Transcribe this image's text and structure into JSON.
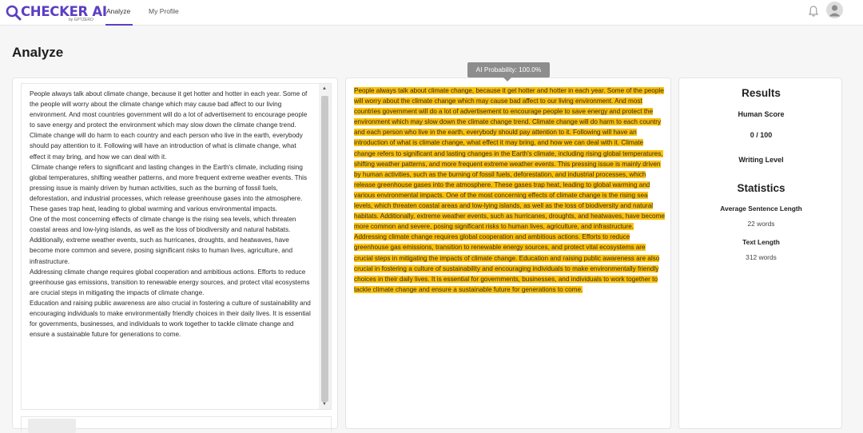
{
  "app": {
    "logo_text": "CHECKER AI",
    "logo_byline": "by GPTZERO",
    "brand_color": "#5c3ec2",
    "highlight_color": "#ffc107"
  },
  "nav": {
    "items": [
      {
        "label": "Analyze",
        "active": true
      },
      {
        "label": "My Profile",
        "active": false
      }
    ],
    "icons": [
      "bell-icon",
      "user-avatar-icon"
    ]
  },
  "page": {
    "title": "Analyze"
  },
  "input": {
    "text": "People always talk about climate change, because it get hotter and hotter in each year. Some of the people will worry about the climate change which may cause bad affect to our living environment. And most countries government will do a lot of advertisement to encourage people to save energy and protect the environment which may slow down the climate change trend. Climate change will do harm to each country and each person who live in the earth, everybody should pay attention to it. Following will have an introduction of what is climate change, what effect it may bring, and how we can deal with it.\n Climate change refers to significant and lasting changes in the Earth's climate, including rising global temperatures, shifting weather patterns, and more frequent extreme weather events. This pressing issue is mainly driven by human activities, such as the burning of fossil fuels, deforestation, and industrial processes, which release greenhouse gases into the atmosphere. These gases trap heat, leading to global warming and various environmental impacts.\nOne of the most concerning effects of climate change is the rising sea levels, which threaten coastal areas and low-lying islands, as well as the loss of biodiversity and natural habitats. Additionally, extreme weather events, such as hurricanes, droughts, and heatwaves, have become more common and severe, posing significant risks to human lives, agriculture, and infrastructure.\nAddressing climate change requires global cooperation and ambitious actions. Efforts to reduce greenhouse gas emissions, transition to renewable energy sources, and protect vital ecosystems are crucial steps in mitigating the impacts of climate change.\nEducation and raising public awareness are also crucial in fostering a culture of sustainability and encouraging individuals to make environmentally friendly choices in their daily lives. It is essential for governments, businesses, and individuals to work together to tackle climate change and ensure a sustainable future for generations to come."
  },
  "output": {
    "tooltip": "AI Probability: 100.0%",
    "highlighted_text": "People always talk about climate change, because it get hotter and hotter in each year. Some of the people will worry about the climate change which may cause bad affect to our living environment. And most countries government will do a lot of advertisement to encourage people to save energy and protect the environment which may slow down the climate change trend. Climate change will do harm to each country and each person who live in the earth, everybody should pay attention to it. Following will have an introduction of what is climate change, what effect it may bring, and how we can deal with it. Climate change refers to significant and lasting changes in the Earth's climate, including rising global temperatures, shifting weather patterns, and more frequent extreme weather events. This pressing issue is mainly driven by human activities, such as the burning of fossil fuels, deforestation, and industrial processes, which release greenhouse gases into the atmosphere. These gases trap heat, leading to global warming and various environmental impacts. One of the most concerning effects of climate change is the rising sea levels, which threaten coastal areas and low-lying islands, as well as the loss of biodiversity and natural habitats. Additionally, extreme weather events, such as hurricanes, droughts, and heatwaves, have become more common and severe, posing significant risks to human lives, agriculture, and infrastructure. Addressing climate change requires global cooperation and ambitious actions. Efforts to reduce greenhouse gas emissions, transition to renewable energy sources, and protect vital ecosystems are crucial steps in mitigating the impacts of climate change. Education and raising public awareness are also crucial in fostering a culture of sustainability and encouraging individuals to make environmentally friendly choices in their daily lives. It is essential for governments, businesses, and individuals to work together to tackle climate change and ensure a sustainable future for generations to come."
  },
  "results": {
    "title": "Results",
    "human_score_label": "Human Score",
    "human_score_value": "0 / 100",
    "writing_level_label": "Writing Level",
    "statistics_title": "Statistics",
    "avg_sentence_label": "Average Sentence Length",
    "avg_sentence_value": "22 words",
    "text_length_label": "Text Length",
    "text_length_value": "312 words"
  }
}
